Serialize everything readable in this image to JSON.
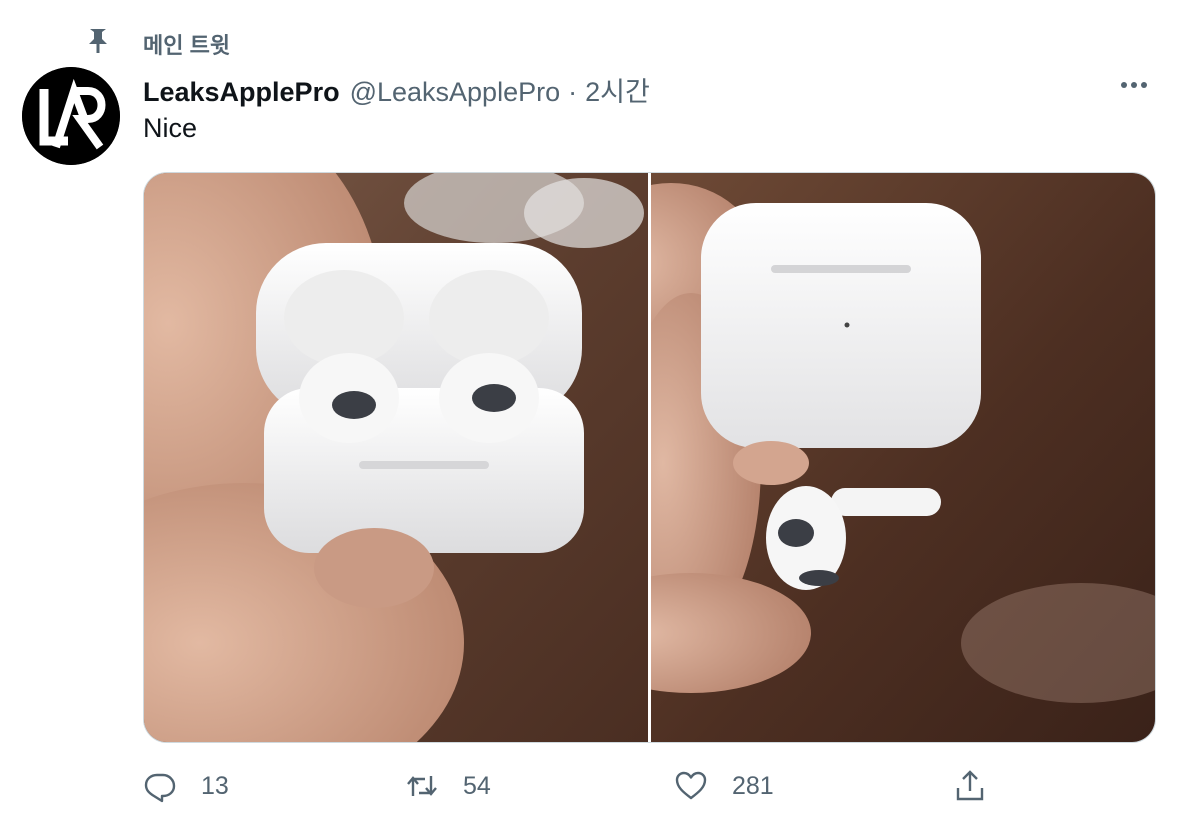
{
  "pinned": {
    "label": "메인 트윗",
    "icon": "pin-icon"
  },
  "tweet": {
    "display_name": "LeaksApplePro",
    "handle": "@LeaksApplePro",
    "separator": "·",
    "time": "2시간",
    "text": "Nice",
    "avatar": {
      "letters": "LAP"
    }
  },
  "media": [
    {
      "description": "hand holding open AirPods case with earbuds"
    },
    {
      "description": "closed AirPods case and single earbud on wooden table"
    }
  ],
  "actions": {
    "reply": {
      "icon": "reply-icon",
      "count": "13"
    },
    "retweet": {
      "icon": "retweet-icon",
      "count": "54"
    },
    "like": {
      "icon": "heart-icon",
      "count": "281"
    },
    "share": {
      "icon": "share-icon"
    }
  },
  "colors": {
    "text": "#0f1419",
    "secondary": "#536471",
    "border": "#cfd9de"
  }
}
